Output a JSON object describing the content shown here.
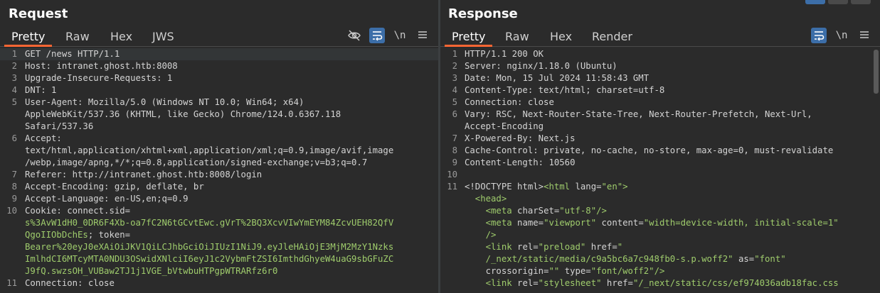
{
  "request": {
    "title": "Request",
    "tabs": [
      "Pretty",
      "Raw",
      "Hex",
      "JWS"
    ],
    "active_tab": "Pretty",
    "tools": {
      "hide": "eye-slash-icon",
      "wrap": "wrap-icon",
      "newline": "\\n",
      "menu": "menu-icon"
    },
    "lines": [
      {
        "n": "1",
        "parts": [
          {
            "t": "GET /news HTTP/1.1",
            "c": "k"
          }
        ]
      },
      {
        "n": "2",
        "parts": [
          {
            "t": "Host: ",
            "c": "k"
          },
          {
            "t": "intranet.ghost.htb:8008",
            "c": "k"
          }
        ]
      },
      {
        "n": "3",
        "parts": [
          {
            "t": "Upgrade-Insecure-Requests: ",
            "c": "k"
          },
          {
            "t": "1",
            "c": "k"
          }
        ]
      },
      {
        "n": "4",
        "parts": [
          {
            "t": "DNT: ",
            "c": "k"
          },
          {
            "t": "1",
            "c": "k"
          }
        ]
      },
      {
        "n": "5",
        "parts": [
          {
            "t": "User-Agent: ",
            "c": "k"
          },
          {
            "t": "Mozilla/5.0 (Windows NT 10.0; Win64; x64)",
            "c": "k"
          }
        ]
      },
      {
        "n": "",
        "parts": [
          {
            "t": "AppleWebKit/537.36 (KHTML, like Gecko) Chrome/124.0.6367.118",
            "c": "k"
          }
        ]
      },
      {
        "n": "",
        "parts": [
          {
            "t": "Safari/537.36",
            "c": "k"
          }
        ]
      },
      {
        "n": "6",
        "parts": [
          {
            "t": "Accept:",
            "c": "k"
          }
        ]
      },
      {
        "n": "",
        "parts": [
          {
            "t": "text/html,application/xhtml+xml,application/xml;q=0.9,image/avif,image",
            "c": "k"
          }
        ]
      },
      {
        "n": "",
        "parts": [
          {
            "t": "/webp,image/apng,*/*;q=0.8,application/signed-exchange;v=b3;q=0.7",
            "c": "k"
          }
        ]
      },
      {
        "n": "7",
        "parts": [
          {
            "t": "Referer: ",
            "c": "k"
          },
          {
            "t": "http://intranet.ghost.htb:8008/login",
            "c": "k"
          }
        ]
      },
      {
        "n": "8",
        "parts": [
          {
            "t": "Accept-Encoding: ",
            "c": "k"
          },
          {
            "t": "gzip, deflate, br",
            "c": "k"
          }
        ]
      },
      {
        "n": "9",
        "parts": [
          {
            "t": "Accept-Language: ",
            "c": "k"
          },
          {
            "t": "en-US,en;q=0.9",
            "c": "k"
          }
        ]
      },
      {
        "n": "10",
        "parts": [
          {
            "t": "Cookie: ",
            "c": "k"
          },
          {
            "t": "connect.sid=",
            "c": "k"
          }
        ]
      },
      {
        "n": "",
        "parts": [
          {
            "t": "s%3AvW1dH0_0DR6F4Xb-oa7fC2N6tGCvtEwc.gVrT%2BQ3XcvVIwYmEYM84ZcvUEH82QfV",
            "c": "g"
          }
        ]
      },
      {
        "n": "",
        "parts": [
          {
            "t": "QgoIIObDchEs",
            "c": "g"
          },
          {
            "t": "; token=",
            "c": "k"
          }
        ]
      },
      {
        "n": "",
        "parts": [
          {
            "t": "Bearer%20eyJ0eXAiOiJKV1QiLCJhbGciOiJIUzI1NiJ9.eyJleHAiOjE3MjM2MzY1Nzks",
            "c": "g"
          }
        ]
      },
      {
        "n": "",
        "parts": [
          {
            "t": "ImlhdCI6MTcyMTA0NDU3OSwidXNlciI6eyJ1c2VybmFtZSI6ImthdGhyeW4uaG9sbGFuZC",
            "c": "g"
          }
        ]
      },
      {
        "n": "",
        "parts": [
          {
            "t": "J9fQ.swzsOH_VUBaw2TJ1j1VGE_bVtwbuHTPgpWTRARfz6r0",
            "c": "g"
          }
        ]
      },
      {
        "n": "11",
        "parts": [
          {
            "t": "Connection: ",
            "c": "k"
          },
          {
            "t": "close",
            "c": "k"
          }
        ]
      }
    ]
  },
  "response": {
    "title": "Response",
    "tabs": [
      "Pretty",
      "Raw",
      "Hex",
      "Render"
    ],
    "active_tab": "Pretty",
    "tools": {
      "wrap": "wrap-icon",
      "newline": "\\n",
      "menu": "menu-icon"
    },
    "lines": [
      {
        "n": "1",
        "parts": [
          {
            "t": "HTTP/1.1 200 OK",
            "c": "k"
          }
        ]
      },
      {
        "n": "2",
        "parts": [
          {
            "t": "Server: ",
            "c": "k"
          },
          {
            "t": "nginx/1.18.0 (Ubuntu)",
            "c": "k"
          }
        ]
      },
      {
        "n": "3",
        "parts": [
          {
            "t": "Date: ",
            "c": "k"
          },
          {
            "t": "Mon, 15 Jul 2024 11:58:43 GMT",
            "c": "k"
          }
        ]
      },
      {
        "n": "4",
        "parts": [
          {
            "t": "Content-Type: ",
            "c": "k"
          },
          {
            "t": "text/html; charset=utf-8",
            "c": "k"
          }
        ]
      },
      {
        "n": "5",
        "parts": [
          {
            "t": "Connection: ",
            "c": "k"
          },
          {
            "t": "close",
            "c": "k"
          }
        ]
      },
      {
        "n": "6",
        "parts": [
          {
            "t": "Vary: ",
            "c": "k"
          },
          {
            "t": "RSC, Next-Router-State-Tree, Next-Router-Prefetch, Next-Url,",
            "c": "k"
          }
        ]
      },
      {
        "n": "",
        "parts": [
          {
            "t": "Accept-Encoding",
            "c": "k"
          }
        ]
      },
      {
        "n": "7",
        "parts": [
          {
            "t": "X-Powered-By: ",
            "c": "k"
          },
          {
            "t": "Next.js",
            "c": "k"
          }
        ]
      },
      {
        "n": "8",
        "parts": [
          {
            "t": "Cache-Control: ",
            "c": "k"
          },
          {
            "t": "private, no-cache, no-store, max-age=0, must-revalidate",
            "c": "k"
          }
        ]
      },
      {
        "n": "9",
        "parts": [
          {
            "t": "Content-Length: ",
            "c": "k"
          },
          {
            "t": "10560",
            "c": "k"
          }
        ]
      },
      {
        "n": "10",
        "parts": []
      },
      {
        "n": "11",
        "parts": [
          {
            "t": "<!DOCTYPE html>",
            "c": "k"
          },
          {
            "t": "<html ",
            "c": "tag"
          },
          {
            "t": "lang=",
            "c": "attr"
          },
          {
            "t": "\"en\"",
            "c": "val"
          },
          {
            "t": ">",
            "c": "tag"
          }
        ]
      },
      {
        "n": "",
        "parts": [
          {
            "t": "  <head>",
            "c": "tag"
          }
        ]
      },
      {
        "n": "",
        "parts": [
          {
            "t": "    <meta ",
            "c": "tag"
          },
          {
            "t": "charSet=",
            "c": "attr"
          },
          {
            "t": "\"utf-8\"",
            "c": "val"
          },
          {
            "t": "/>",
            "c": "tag"
          }
        ]
      },
      {
        "n": "",
        "parts": [
          {
            "t": "    <meta ",
            "c": "tag"
          },
          {
            "t": "name=",
            "c": "attr"
          },
          {
            "t": "\"viewport\" ",
            "c": "val"
          },
          {
            "t": "content=",
            "c": "attr"
          },
          {
            "t": "\"width=device-width, initial-scale=1\"",
            "c": "val"
          }
        ]
      },
      {
        "n": "",
        "parts": [
          {
            "t": "    />",
            "c": "tag"
          }
        ]
      },
      {
        "n": "",
        "parts": [
          {
            "t": "    <link ",
            "c": "tag"
          },
          {
            "t": "rel=",
            "c": "attr"
          },
          {
            "t": "\"preload\" ",
            "c": "val"
          },
          {
            "t": "href=",
            "c": "attr"
          },
          {
            "t": "\"",
            "c": "val"
          }
        ]
      },
      {
        "n": "",
        "parts": [
          {
            "t": "    /_next/static/media/c9a5bc6a7c948fb0-s.p.woff2\" ",
            "c": "val"
          },
          {
            "t": "as=",
            "c": "attr"
          },
          {
            "t": "\"font\"",
            "c": "val"
          }
        ]
      },
      {
        "n": "",
        "parts": [
          {
            "t": "    crossorigin=",
            "c": "attr"
          },
          {
            "t": "\"\" ",
            "c": "val"
          },
          {
            "t": "type=",
            "c": "attr"
          },
          {
            "t": "\"font/woff2\"",
            "c": "val"
          },
          {
            "t": "/>",
            "c": "tag"
          }
        ]
      },
      {
        "n": "",
        "parts": [
          {
            "t": "    <link ",
            "c": "tag"
          },
          {
            "t": "rel=",
            "c": "attr"
          },
          {
            "t": "\"stylesheet\" ",
            "c": "val"
          },
          {
            "t": "href=",
            "c": "attr"
          },
          {
            "t": "\"/_next/static/css/ef974036adb18fac.css",
            "c": "val"
          }
        ]
      }
    ]
  }
}
